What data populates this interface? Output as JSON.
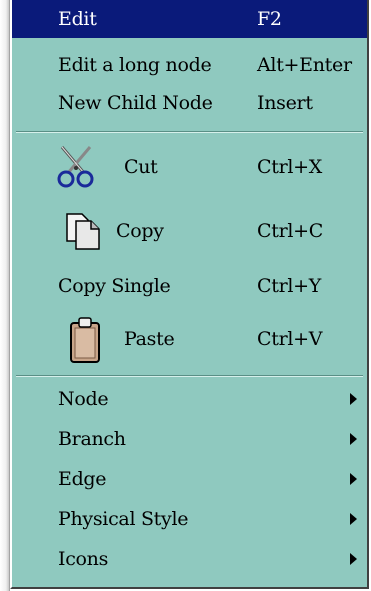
{
  "menu": {
    "items": [
      {
        "label": "Edit",
        "shortcut": "F2"
      },
      {
        "label": "Edit a long node",
        "shortcut": "Alt+Enter"
      },
      {
        "label": "New Child Node",
        "shortcut": "Insert"
      },
      {
        "label": "Cut",
        "shortcut": "Ctrl+X",
        "icon": "scissors-icon"
      },
      {
        "label": "Copy",
        "shortcut": "Ctrl+C",
        "icon": "copy-documents-icon"
      },
      {
        "label": "Copy Single",
        "shortcut": "Ctrl+Y"
      },
      {
        "label": "Paste",
        "shortcut": "Ctrl+V",
        "icon": "clipboard-icon"
      },
      {
        "label": "Node"
      },
      {
        "label": "Branch"
      },
      {
        "label": "Edge"
      },
      {
        "label": "Physical Style"
      },
      {
        "label": "Icons"
      }
    ],
    "selected_index": 0
  },
  "colors": {
    "menu_background": "#8fc9bf",
    "highlight": "#0a1a7a",
    "highlight_text": "#ffffff"
  }
}
